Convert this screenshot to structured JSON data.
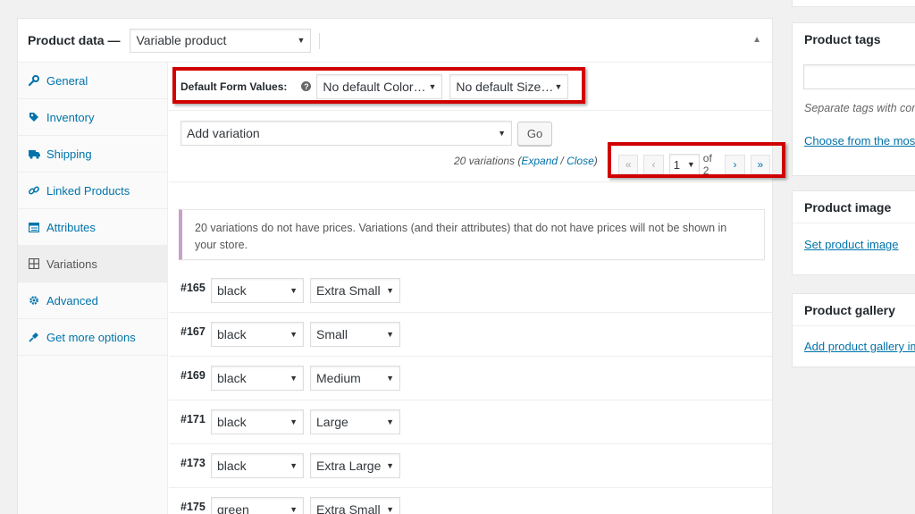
{
  "product_data": {
    "title": "Product data —",
    "type_select": "Variable product"
  },
  "tabs": [
    {
      "label": "General",
      "icon": "wrench-icon"
    },
    {
      "label": "Inventory",
      "icon": "tag-icon"
    },
    {
      "label": "Shipping",
      "icon": "truck-icon"
    },
    {
      "label": "Linked Products",
      "icon": "link-icon"
    },
    {
      "label": "Attributes",
      "icon": "list-icon"
    },
    {
      "label": "Variations",
      "icon": "grid-icon"
    },
    {
      "label": "Advanced",
      "icon": "gear-icon"
    },
    {
      "label": "Get more options",
      "icon": "plugin-icon"
    }
  ],
  "active_tab": "Variations",
  "default_form": {
    "label": "Default Form Values:",
    "color_select": "No default Color…",
    "size_select": "No default Size…"
  },
  "add_variation": {
    "select": "Add variation",
    "go": "Go",
    "count_text": "20 variations (",
    "expand": "Expand",
    "slash": " / ",
    "close": "Close",
    "close_paren": ")"
  },
  "pagination": {
    "first": "«",
    "prev": "‹",
    "current": "1",
    "of_text": "of 2",
    "next": "›",
    "last": "»"
  },
  "notice": "20 variations do not have prices. Variations (and their attributes) that do not have prices will not be shown in your store.",
  "variations": [
    {
      "id": "#165",
      "color": "black",
      "size": "Extra Small"
    },
    {
      "id": "#167",
      "color": "black",
      "size": "Small"
    },
    {
      "id": "#169",
      "color": "black",
      "size": "Medium"
    },
    {
      "id": "#171",
      "color": "black",
      "size": "Large"
    },
    {
      "id": "#173",
      "color": "black",
      "size": "Extra Large"
    },
    {
      "id": "#175",
      "color": "green",
      "size": "Extra Small"
    }
  ],
  "sidebar": {
    "tags_title": "Product tags",
    "tags_hint": "Separate tags with commas",
    "tags_link": "Choose from the most used tags",
    "image_title": "Product image",
    "image_link": "Set product image",
    "gallery_title": "Product gallery",
    "gallery_link": "Add product gallery images"
  },
  "colors": {
    "link": "#0073aa",
    "highlight_box": "#d10000",
    "notice_border": "#c9a0c8"
  }
}
